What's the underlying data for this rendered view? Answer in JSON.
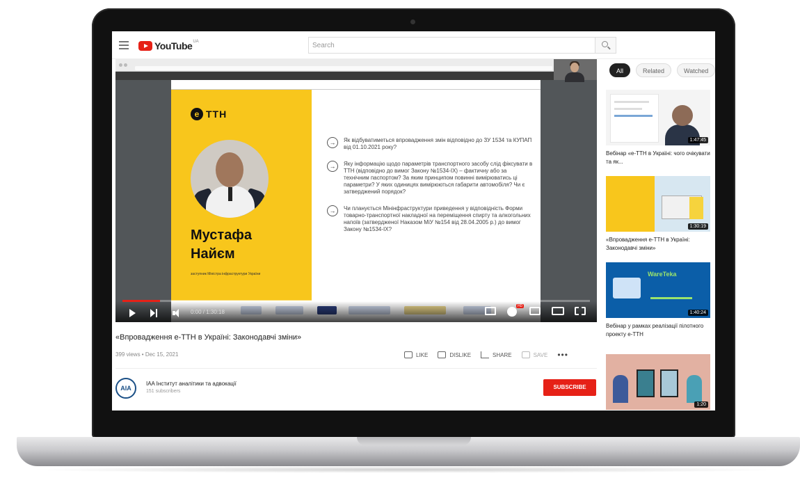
{
  "youtube": {
    "logo_text": "YouTube",
    "region": "UA",
    "search_placeholder": "Search"
  },
  "video": {
    "title": "«Впровадження е-ТТН в Україні: Законодавчі зміни»",
    "meta": "399 views • Dec 15, 2021",
    "time_display": "0:00 / 1:30:18",
    "progress_fraction": 0.08,
    "slide": {
      "brand": "TTH",
      "speaker_name_line1": "Мустафа",
      "speaker_name_line2": "Найєм",
      "speaker_role": "заступник Міністра інфраструктури України",
      "questions": [
        "Як відбуватиметься впровадження змін відповідно до ЗУ 1534 та КУПАП від 01.10.2021 року?",
        "Яку інформацію щодо параметрів транспортного засобу слід фіксувати в ТТН (відповідно до вимог Закону №1534-IX) – фактичну або за технічним паспортом? За яким принципом повинні вимірюватись ці параметри? У яких одиницях вимірюються габарити автомобіля? Чи є затверджений порядок?",
        "Чи планується Мінінфраструктури приведення у відповідність Форми товарно-транспортної накладної на переміщення спирту та алкогольних напоїв (затвердженої Наказом МіУ №154 від 28.04.2005 р.) до вимог Закону №1534-IX?"
      ]
    }
  },
  "actions": {
    "like": "LIKE",
    "dislike": "DISLIKE",
    "share": "SHARE",
    "save": "SAVE",
    "more": "•••"
  },
  "channel": {
    "avatar_text": "AIA",
    "name": "IAA Інститут аналітики та адвокації",
    "subscribers": "151 subscribers",
    "subscribe_label": "SUBSCRIBE"
  },
  "chips": [
    "All",
    "Related",
    "Watched"
  ],
  "recommendations": [
    {
      "title": "Вебінар «е-ТТН в Україні: чого очікувати та як...",
      "duration": "1:47:45"
    },
    {
      "title": "«Впровадження е-ТТН в Україні: Законодавчі зміни»",
      "duration": "1:30:19"
    },
    {
      "title": "Вебінар у рамках реалізації пілотного проекту е-ТТН",
      "duration": "1:40:24",
      "brand": "WareTeka"
    },
    {
      "title": "",
      "duration": "1:20"
    }
  ],
  "colors": {
    "youtube_red": "#e62117",
    "slide_yellow": "#f8c61c",
    "subscribe_red": "#e62117"
  }
}
